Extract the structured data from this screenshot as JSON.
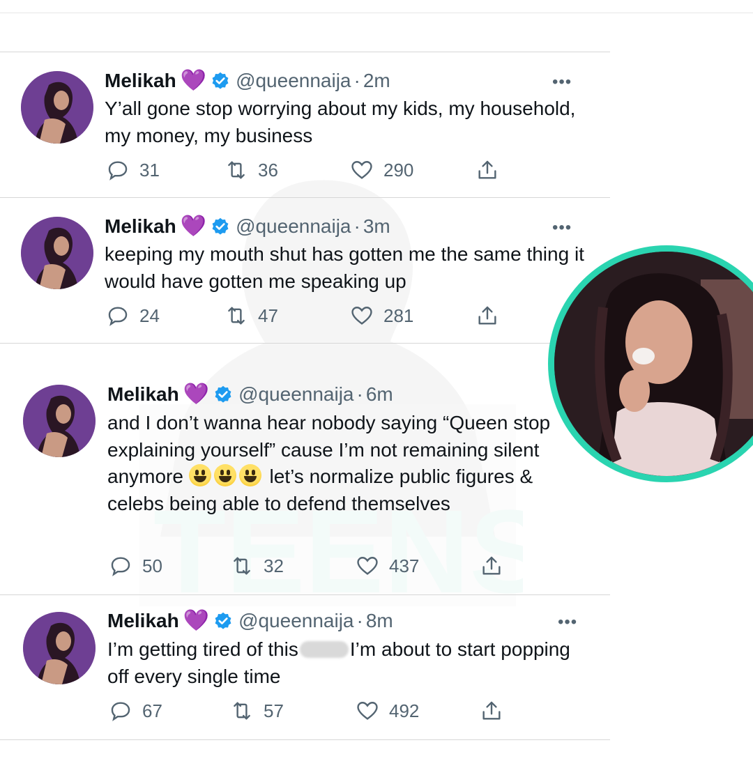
{
  "tweets": [
    {
      "name": "Melikah",
      "handle": "@queennaija",
      "time": "2m",
      "text": "Y’all gone stop worrying about my kids, my household, my money, my business",
      "replies": "31",
      "retweets": "36",
      "likes": "290"
    },
    {
      "name": "Melikah",
      "handle": "@queennaija",
      "time": "3m",
      "text": "keeping my mouth shut has gotten me the same thing it would have gotten me speaking up",
      "replies": "24",
      "retweets": "47",
      "likes": "281"
    },
    {
      "name": "Melikah",
      "handle": "@queennaija",
      "time": "6m",
      "text_a": "and I don’t wanna hear nobody saying “Queen stop explaining yourself” cause I’m not remaining silent anymore",
      "text_b": "let’s normalize public figures & celebs being able to defend themselves",
      "replies": "50",
      "retweets": "32",
      "likes": "437"
    },
    {
      "name": "Melikah",
      "handle": "@queennaija",
      "time": "8m",
      "text_a": "I’m getting tired of this",
      "text_b": "I’m about to start popping off every single time",
      "replies": "67",
      "retweets": "57",
      "likes": "492"
    }
  ],
  "common": {
    "heart_emoji": "💜",
    "dot": "·",
    "more": "•••"
  },
  "colors": {
    "name": "#0f1419",
    "muted": "#536471",
    "verified": "#1d9bf0",
    "heart": "#9b30ff",
    "inset_border": "#2ad4b0"
  },
  "icons": [
    "reply-icon",
    "retweet-icon",
    "like-icon",
    "share-icon",
    "verified-badge-icon",
    "more-icon"
  ]
}
